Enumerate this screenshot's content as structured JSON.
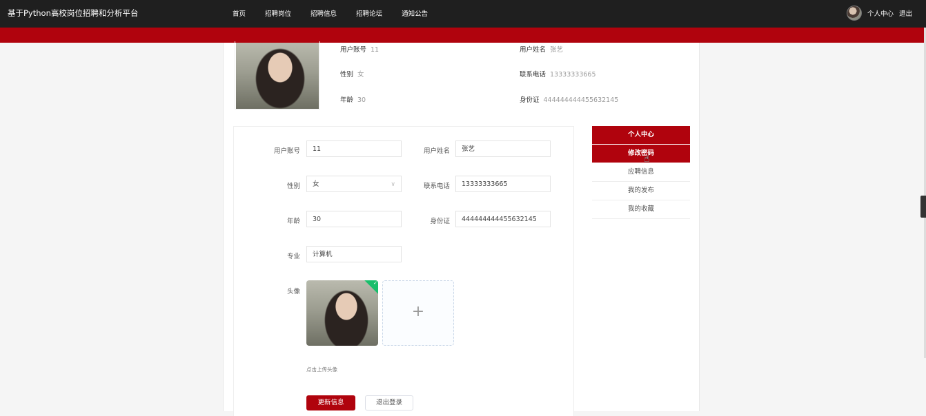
{
  "header": {
    "site_title": "基于Python高校岗位招聘和分析平台",
    "nav": [
      "首页",
      "招聘岗位",
      "招聘信息",
      "招聘论坛",
      "通知公告"
    ],
    "user_center": "个人中心",
    "logout": "退出"
  },
  "profile": {
    "account_label": "用户账号",
    "account_value": "11",
    "name_label": "用户姓名",
    "name_value": "张艺",
    "gender_label": "性别",
    "gender_value": "女",
    "phone_label": "联系电话",
    "phone_value": "13333333665",
    "age_label": "年龄",
    "age_value": "30",
    "id_label": "身份证",
    "id_value": "444444444455632145"
  },
  "form": {
    "account_label": "用户账号",
    "account_value": "11",
    "name_label": "用户姓名",
    "name_value": "张艺",
    "gender_label": "性别",
    "gender_value": "女",
    "phone_label": "联系电话",
    "phone_value": "13333333665",
    "age_label": "年龄",
    "age_value": "30",
    "id_label": "身份证",
    "id_value": "444444444455632145",
    "major_label": "专业",
    "major_value": "计算机",
    "avatar_label": "头像",
    "upload_plus": "+",
    "upload_hint": "点击上传头像",
    "update_button": "更新信息",
    "logout_button": "退出登录"
  },
  "side_menu": {
    "items": [
      "个人中心",
      "修改密码",
      "应聘信息",
      "我的发布",
      "我的收藏"
    ]
  },
  "colors": {
    "brand_red": "#b0030d",
    "top_bar": "#1f1f1f",
    "success_green": "#19be6b"
  }
}
